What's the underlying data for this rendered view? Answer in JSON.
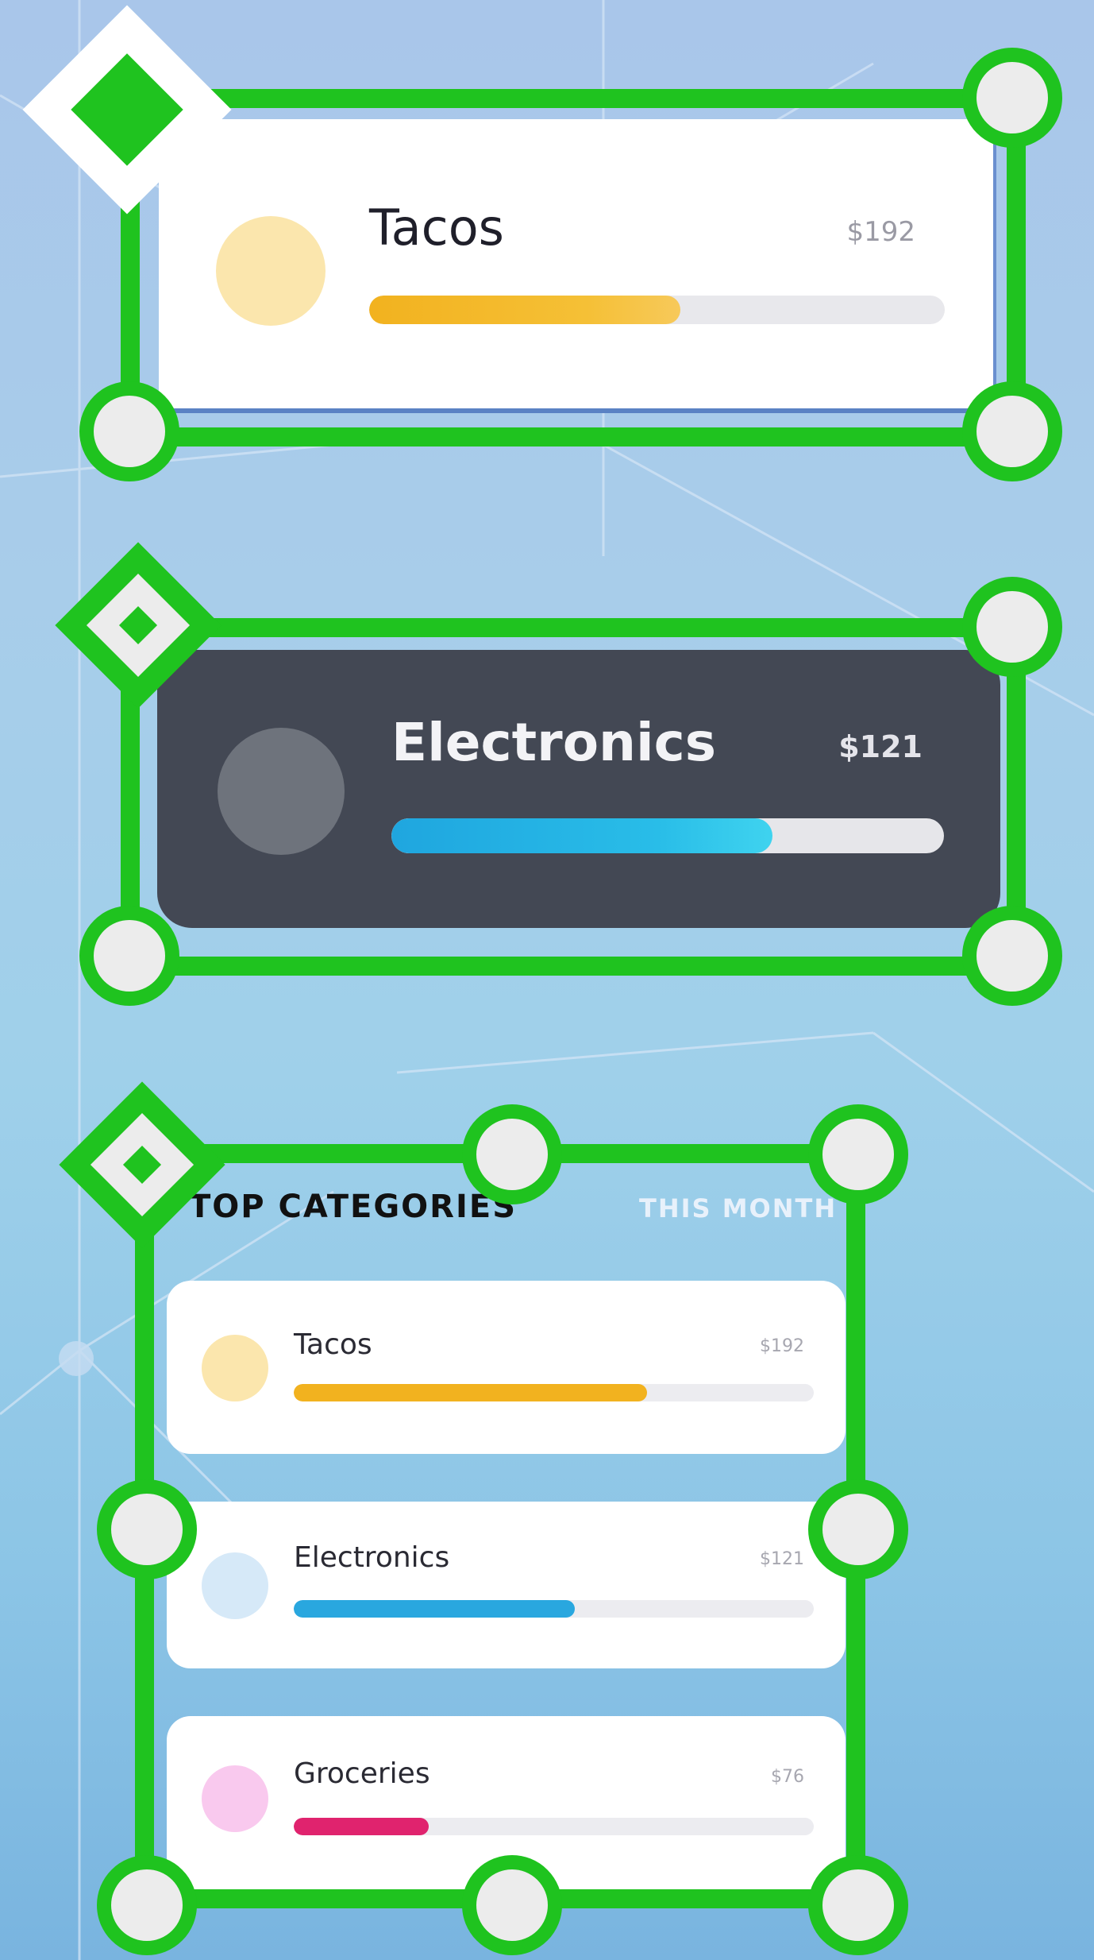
{
  "card_tacos": {
    "name": "Tacos",
    "amount": "$192",
    "progress": 0.54,
    "color": "#f2b21f"
  },
  "card_electronics": {
    "name": "Electronics",
    "amount": "$121",
    "progress": 0.69,
    "color": "#29bde8"
  },
  "list_panel": {
    "title": "TOP CATEGORIES",
    "tab": "THIS MONTH",
    "items": [
      {
        "name": "Tacos",
        "amount": "$192",
        "progress": 0.68,
        "dot_color": "#fbe6ad",
        "bar_color": "#f2b21f"
      },
      {
        "name": "Electronics",
        "amount": "$121",
        "progress": 0.54,
        "dot_color": "#d6e9f8",
        "bar_color": "#29a7df"
      },
      {
        "name": "Groceries",
        "amount": "$76",
        "progress": 0.26,
        "dot_color": "#f9c9ee",
        "bar_color": "#e0236e"
      }
    ]
  },
  "colors": {
    "selection": "#1fc31f",
    "handle_fill": "#ececec"
  },
  "icons": {
    "handle": "resize-handle-circle",
    "anchor": "anchor-diamond"
  }
}
